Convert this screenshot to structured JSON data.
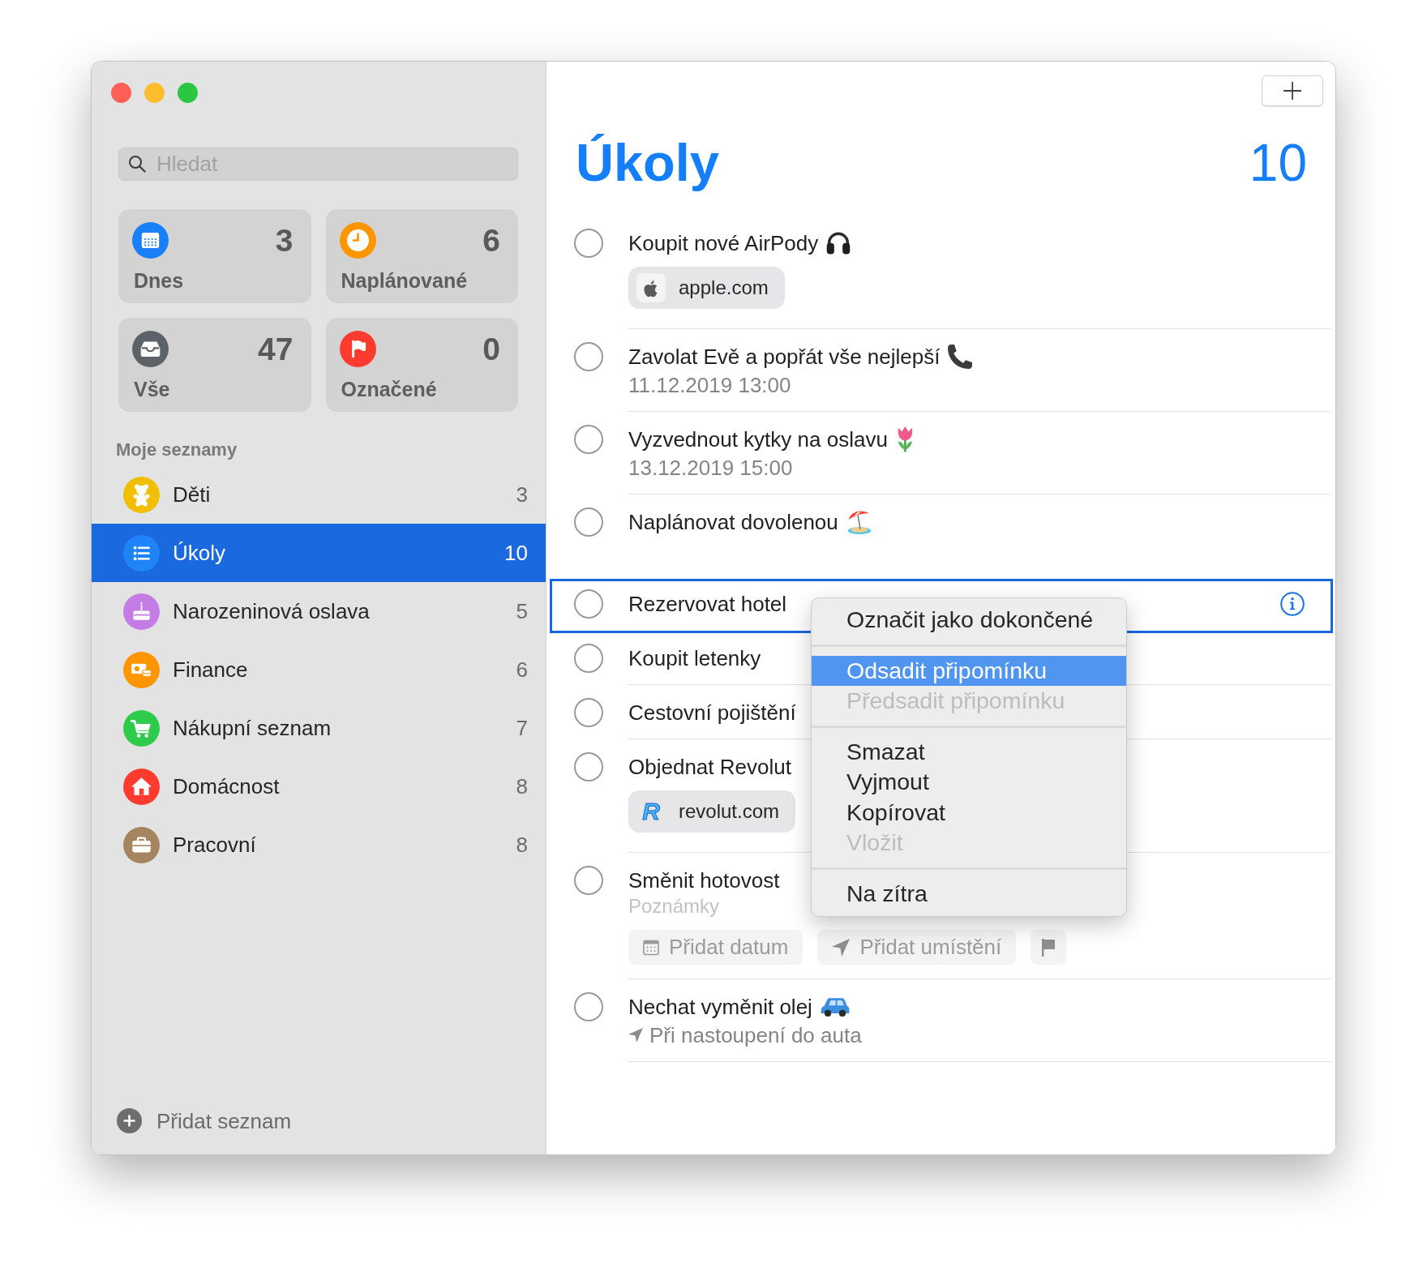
{
  "window_buttons": [
    {
      "color": "#fe5f57"
    },
    {
      "color": "#febc2e"
    },
    {
      "color": "#29c840"
    }
  ],
  "sidebar": {
    "search": {
      "placeholder": "Hledat"
    },
    "smart_lists": [
      {
        "color": "#1a80f7",
        "count": "3",
        "label": "Dnes"
      },
      {
        "color": "#ff9500",
        "count": "6",
        "label": "Naplánované"
      },
      {
        "color": "#5d6168",
        "count": "47",
        "label": "Vše"
      },
      {
        "color": "#ff3b30",
        "count": "0",
        "label": "Označené"
      }
    ],
    "section_title": "Moje seznamy",
    "lists": [
      {
        "color": "#f2bf00",
        "name": "Děti",
        "count": "3",
        "selected": false
      },
      {
        "color": "#1f84f9",
        "name": "Úkoly",
        "count": "10",
        "selected": true
      },
      {
        "color": "#c57de6",
        "name": "Narozeninová oslava",
        "count": "5",
        "selected": false
      },
      {
        "color": "#ff9500",
        "name": "Finance",
        "count": "6",
        "selected": false
      },
      {
        "color": "#2ecc4c",
        "name": "Nákupní seznam",
        "count": "7",
        "selected": false
      },
      {
        "color": "#ff3b30",
        "name": "Domácnost",
        "count": "8",
        "selected": false
      },
      {
        "color": "#a4855f",
        "name": "Pracovní",
        "count": "8",
        "selected": false
      }
    ],
    "add_list": "Přidat seznam"
  },
  "main": {
    "title": "Úkoly",
    "count": "10",
    "tasks": [
      {
        "title": "Koupit nové AirPody",
        "checked": false,
        "selected": false,
        "link": {
          "label": "apple.com"
        }
      },
      {
        "title": "Zavolat Evě a popřát vše nejlepší",
        "checked": false,
        "selected": false,
        "due": "11.12.2019 13:00"
      },
      {
        "title": "Vyzvednout kytky na oslavu",
        "checked": false,
        "selected": false,
        "due": "13.12.2019 15:00"
      },
      {
        "title": "Naplánovat dovolenou",
        "checked": false,
        "selected": false
      },
      {
        "title": "Rezervovat hotel",
        "checked": false,
        "selected": true
      },
      {
        "title": "Koupit letenky",
        "checked": false,
        "selected": false
      },
      {
        "title": "Cestovní pojištění",
        "checked": false,
        "selected": false
      },
      {
        "title": "Objednat Revolut",
        "checked": false,
        "selected": false,
        "link": {
          "letter": "R",
          "label": "revolut.com"
        }
      },
      {
        "title": "Směnit hotovost",
        "checked": false,
        "selected": false,
        "editor": {
          "notes": {
            "placeholder": "Poznámky"
          },
          "buttons": [
            {
              "kind": "date",
              "label": "Přidat datum"
            },
            {
              "kind": "location",
              "label": "Přidat umístění"
            },
            {
              "kind": "flag"
            }
          ]
        }
      },
      {
        "title": "Nechat vyměnit olej",
        "checked": false,
        "selected": false,
        "location": "Při nastoupení do auta"
      }
    ]
  },
  "context_menu": {
    "sections": [
      {
        "items": [
          {
            "label": "Označit jako dokončené",
            "selected": false,
            "disabled": false
          }
        ]
      },
      {
        "items": [
          {
            "label": "Odsadit připomínku",
            "selected": true,
            "disabled": false
          },
          {
            "label": "Předsadit připomínku",
            "selected": false,
            "disabled": true
          }
        ]
      },
      {
        "items": [
          {
            "label": "Smazat",
            "selected": false,
            "disabled": false
          },
          {
            "label": "Vyjmout",
            "selected": false,
            "disabled": false
          },
          {
            "label": "Kopírovat",
            "selected": false,
            "disabled": false
          },
          {
            "label": "Vložit",
            "selected": false,
            "disabled": true
          }
        ]
      },
      {
        "items": [
          {
            "label": "Na zítra",
            "selected": false,
            "disabled": false
          }
        ]
      }
    ]
  }
}
